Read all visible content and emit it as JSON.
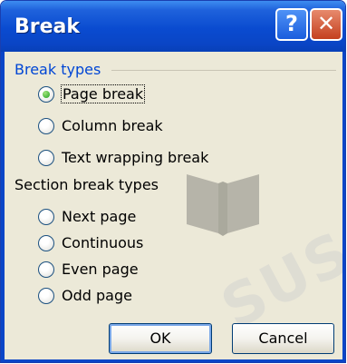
{
  "window": {
    "title": "Break",
    "help_glyph": "?",
    "close_glyph": "✕"
  },
  "break_types": {
    "group_label": "Break types",
    "options": [
      {
        "label": "Page break",
        "selected": true
      },
      {
        "label": "Column break",
        "selected": false
      },
      {
        "label": "Text wrapping break",
        "selected": false
      }
    ]
  },
  "section_break_types": {
    "group_label": "Section break types",
    "options": [
      {
        "label": "Next page",
        "selected": false
      },
      {
        "label": "Continuous",
        "selected": false
      },
      {
        "label": "Even page",
        "selected": false
      },
      {
        "label": "Odd page",
        "selected": false
      }
    ]
  },
  "buttons": {
    "ok": "OK",
    "cancel": "Cancel"
  },
  "watermark": {
    "text": "SUS"
  },
  "colors": {
    "titlebar": "#0a4bd0",
    "group_label": "#0046d5",
    "dialog_bg": "#ece9d8",
    "radio_dot": "#21a121"
  }
}
